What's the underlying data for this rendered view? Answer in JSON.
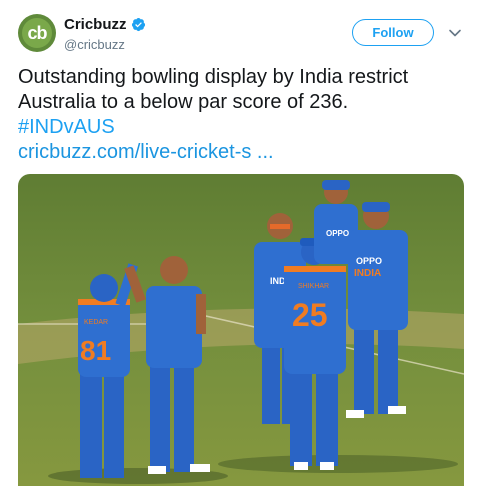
{
  "account": {
    "display_name": "Cricbuzz",
    "handle": "@cricbuzz",
    "avatar_text": "cb",
    "verified": true
  },
  "header": {
    "follow_label": "Follow",
    "menu_icon": "chevron-down-icon"
  },
  "tweet": {
    "line1": "Outstanding bowling display by India restrict",
    "line2": "Australia to a below par score of 236.",
    "hashtag": "#INDvAUS",
    "link": "cricbuzz.com/live-cricket-s  ..."
  },
  "photo": {
    "jersey_texts": [
      "81",
      "25",
      "INDIA",
      "OPPO"
    ],
    "name_text_1": "KEDAR",
    "name_text_2": "SHIKHAR"
  },
  "colors": {
    "brand_blue": "#1da1f2",
    "text": "#14171a",
    "muted": "#657786",
    "jersey_blue": "#2a64c5",
    "jersey_orange": "#f07c22",
    "grass": "#6f8f3a"
  }
}
